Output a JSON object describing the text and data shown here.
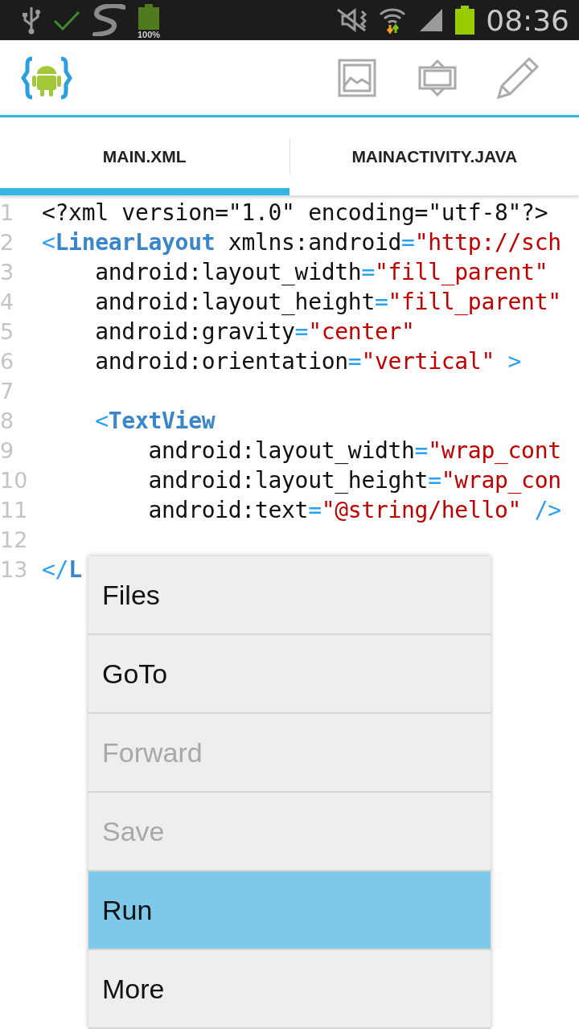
{
  "status_bar": {
    "battery_text": "100%",
    "time": "08:36"
  },
  "tabs": [
    {
      "label": "MAIN.XML",
      "selected": true
    },
    {
      "label": "MAINACTIVITY.JAVA",
      "selected": false
    }
  ],
  "editor": {
    "lines": [
      {
        "number": "1",
        "tokens": [
          {
            "kind": "plain",
            "text": "<?xml version=\"1.0\" encoding=\"utf-8\"?>"
          }
        ]
      },
      {
        "number": "2",
        "tokens": [
          {
            "kind": "punct",
            "text": "<"
          },
          {
            "kind": "tag",
            "text": "LinearLayout"
          },
          {
            "kind": "plain",
            "text": " xmlns:android"
          },
          {
            "kind": "punct",
            "text": "="
          },
          {
            "kind": "string",
            "text": "\"http://sch"
          }
        ]
      },
      {
        "number": "3",
        "tokens": [
          {
            "kind": "plain",
            "text": "    android:layout_width"
          },
          {
            "kind": "punct",
            "text": "="
          },
          {
            "kind": "string",
            "text": "\"fill_parent\""
          }
        ]
      },
      {
        "number": "4",
        "tokens": [
          {
            "kind": "plain",
            "text": "    android:layout_height"
          },
          {
            "kind": "punct",
            "text": "="
          },
          {
            "kind": "string",
            "text": "\"fill_parent\""
          }
        ]
      },
      {
        "number": "5",
        "tokens": [
          {
            "kind": "plain",
            "text": "    android:gravity"
          },
          {
            "kind": "punct",
            "text": "="
          },
          {
            "kind": "string",
            "text": "\"center\""
          }
        ]
      },
      {
        "number": "6",
        "tokens": [
          {
            "kind": "plain",
            "text": "    android:orientation"
          },
          {
            "kind": "punct",
            "text": "="
          },
          {
            "kind": "string",
            "text": "\"vertical\""
          },
          {
            "kind": "punct",
            "text": " >"
          }
        ]
      },
      {
        "number": "7"
      },
      {
        "number": "8",
        "tokens": [
          {
            "kind": "punct",
            "text": "    <"
          },
          {
            "kind": "tag",
            "text": "TextView"
          }
        ]
      },
      {
        "number": "9",
        "tokens": [
          {
            "kind": "plain",
            "text": "        android:layout_width"
          },
          {
            "kind": "punct",
            "text": "="
          },
          {
            "kind": "string",
            "text": "\"wrap_cont"
          }
        ]
      },
      {
        "number": "10",
        "tokens": [
          {
            "kind": "plain",
            "text": "        android:layout_height"
          },
          {
            "kind": "punct",
            "text": "="
          },
          {
            "kind": "string",
            "text": "\"wrap_con"
          }
        ]
      },
      {
        "number": "11",
        "tokens": [
          {
            "kind": "plain",
            "text": "        android:text"
          },
          {
            "kind": "punct",
            "text": "="
          },
          {
            "kind": "string",
            "text": "\"@string/hello\""
          },
          {
            "kind": "punct",
            "text": " />"
          }
        ]
      },
      {
        "number": "12"
      },
      {
        "number": "13",
        "tokens": [
          {
            "kind": "punct",
            "text": "</"
          },
          {
            "kind": "tag",
            "text": "L"
          }
        ]
      }
    ]
  },
  "menu": {
    "items": [
      {
        "label": "Files",
        "disabled": false,
        "selected": false
      },
      {
        "label": "GoTo",
        "disabled": false,
        "selected": false
      },
      {
        "label": "Forward",
        "disabled": true,
        "selected": false
      },
      {
        "label": "Save",
        "disabled": true,
        "selected": false
      },
      {
        "label": "Run",
        "disabled": false,
        "selected": true
      },
      {
        "label": "More",
        "disabled": false,
        "selected": false
      }
    ]
  }
}
